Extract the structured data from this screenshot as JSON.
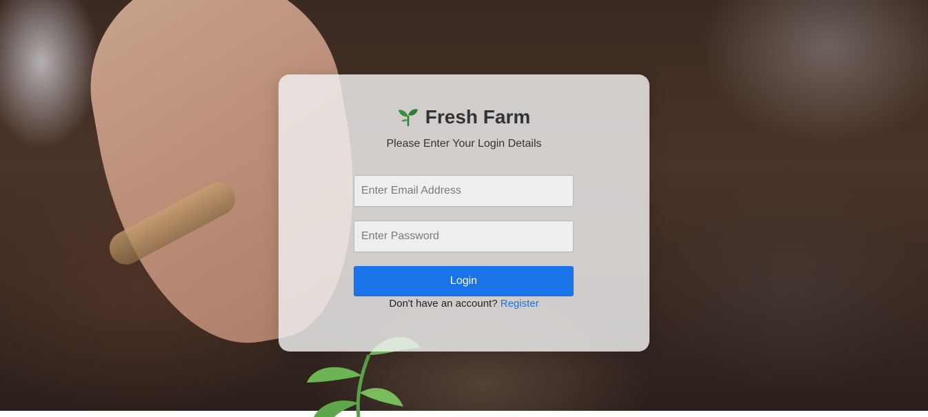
{
  "brand": {
    "icon": "seedling-icon",
    "name": "Fresh Farm"
  },
  "subtitle": "Please Enter Your Login Details",
  "form": {
    "email_placeholder": "Enter Email Address",
    "email_value": "",
    "password_placeholder": "Enter Password",
    "password_value": "",
    "login_label": "Login"
  },
  "register": {
    "prompt": "Don't have an account?",
    "link_label": "Register"
  },
  "colors": {
    "accent": "#1a73e8",
    "card": "#f0f0f0",
    "brand_icon": "#2e7d32"
  }
}
